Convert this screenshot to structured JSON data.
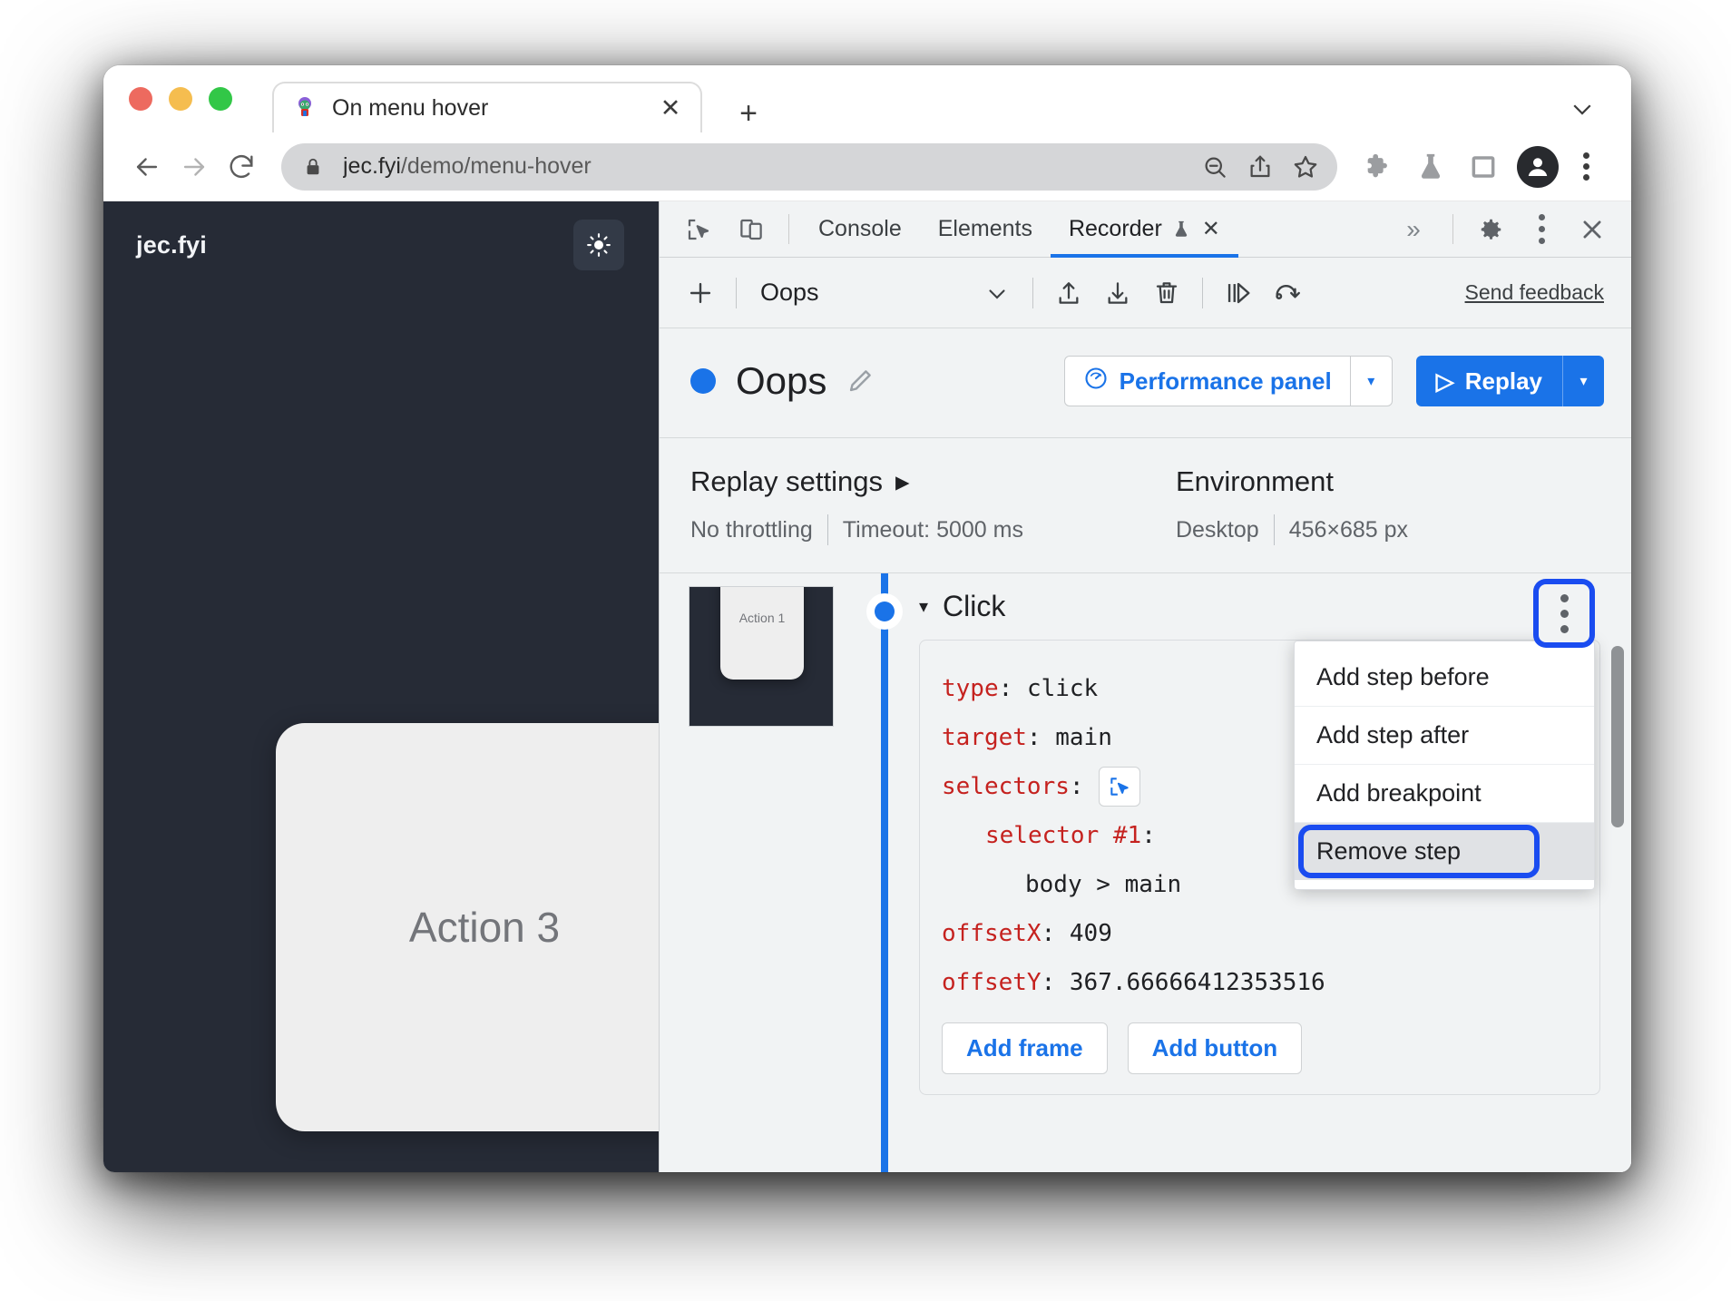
{
  "browser": {
    "tab": {
      "title": "On menu hover",
      "favicon": "page-favicon",
      "close_label": "✕"
    },
    "new_tab_label": "+",
    "omnibox": {
      "url_host": "jec.fyi",
      "url_path": "/demo/menu-hover",
      "lock": "lock-icon"
    },
    "nav": {
      "back": "←",
      "forward": "→",
      "reload": "↻"
    },
    "toolbar_icons": [
      "zoom-out-icon",
      "share-icon",
      "bookmark-star-icon",
      "extensions-puzzle-icon",
      "labs-flask-icon",
      "side-panel-icon",
      "profile-avatar-icon",
      "chrome-menu-icon"
    ]
  },
  "page": {
    "brand": "jec.fyi",
    "theme_toggle": "sun-icon",
    "card_label": "Action 3"
  },
  "devtools": {
    "tabs": [
      {
        "label": "Console",
        "active": false
      },
      {
        "label": "Elements",
        "active": false
      },
      {
        "label": "Recorder",
        "active": true,
        "experimental": true,
        "closable": true
      }
    ],
    "tab_close_label": "✕",
    "overflow_label": "»",
    "left_icons": [
      "inspect-element-icon",
      "device-toolbar-icon"
    ],
    "right_icons": [
      "settings-gear-icon",
      "devtools-kebab-icon",
      "devtools-close-icon"
    ],
    "recorder": {
      "toolbar": {
        "add_label": "+",
        "recording_name": "Oops",
        "dropdown_label": "⌄",
        "icons": [
          "export-icon",
          "import-icon",
          "delete-icon",
          "step-over-icon",
          "replay-loop-icon"
        ],
        "feedback_label": "Send feedback"
      },
      "header": {
        "title": "Oops",
        "edit_icon": "pencil-icon",
        "performance_button": "Performance panel",
        "performance_icon": "performance-gauge-icon",
        "performance_arrow": "▾",
        "replay_button": "Replay",
        "replay_icon": "▷",
        "replay_arrow": "▾"
      },
      "settings": {
        "replay_heading": "Replay settings",
        "replay_heading_caret": "▸",
        "throttling": "No throttling",
        "timeout": "Timeout: 5000 ms",
        "environment_heading": "Environment",
        "device": "Desktop",
        "viewport": "456×685 px"
      },
      "step": {
        "thumbnail_label": "Action 1",
        "caret": "▾",
        "title": "Click",
        "menu_icon": "step-kebab-icon",
        "code": [
          {
            "key": "type",
            "value": "click",
            "indent": 0
          },
          {
            "key": "target",
            "value": "main",
            "indent": 0
          },
          {
            "key": "selectors",
            "value": "",
            "indent": 0,
            "picker": true
          },
          {
            "key": "selector #1",
            "value": "",
            "indent": 1
          },
          {
            "key": "",
            "value": "body > main",
            "indent": 2
          },
          {
            "key": "offsetX",
            "value": "409",
            "indent": 0
          },
          {
            "key": "offsetY",
            "value": "367.66666412353516",
            "indent": 0
          }
        ],
        "buttons": [
          "Add frame",
          "Add button"
        ]
      },
      "context_menu": {
        "items": [
          {
            "label": "Add step before",
            "highlighted": false
          },
          {
            "label": "Add step after",
            "highlighted": false
          },
          {
            "label": "Add breakpoint",
            "highlighted": false
          },
          {
            "label": "Remove step",
            "highlighted": true
          }
        ]
      }
    }
  },
  "colors": {
    "accent_blue": "#1a73e8",
    "highlight_blue": "#1a4cf0",
    "code_key_red": "#c5221f",
    "page_dark": "#262b36"
  }
}
